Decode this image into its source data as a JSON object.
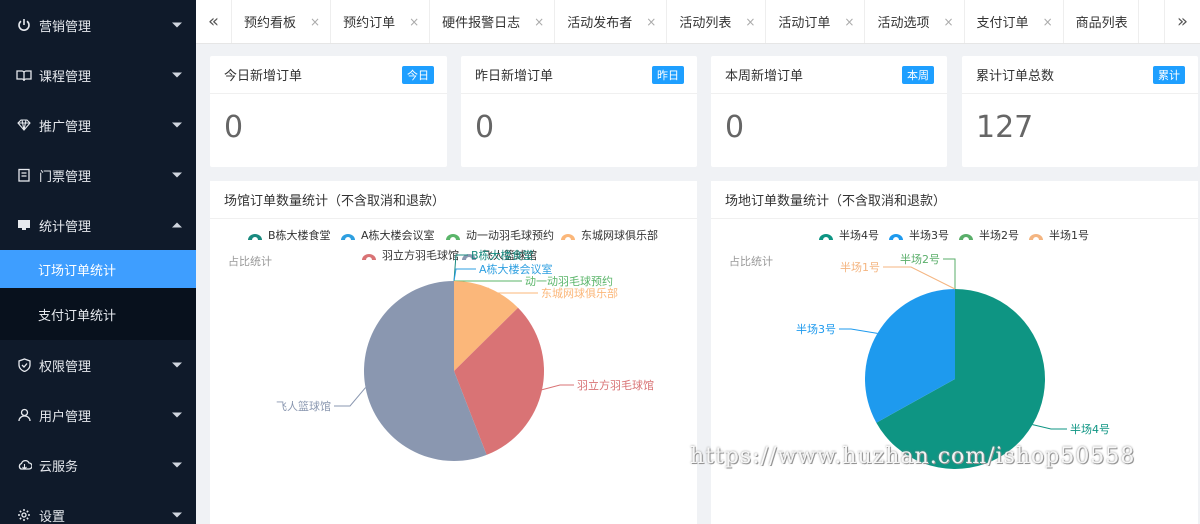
{
  "sidebar": {
    "items": [
      {
        "label": "营销管理",
        "icon": "power-icon",
        "expanded": false
      },
      {
        "label": "课程管理",
        "icon": "book-icon",
        "expanded": false
      },
      {
        "label": "推广管理",
        "icon": "diamond-icon",
        "expanded": false
      },
      {
        "label": "门票管理",
        "icon": "ticket-icon",
        "expanded": false
      },
      {
        "label": "统计管理",
        "icon": "chart-icon",
        "expanded": true
      },
      {
        "label": "权限管理",
        "icon": "shield-icon",
        "expanded": false
      },
      {
        "label": "用户管理",
        "icon": "user-icon",
        "expanded": false
      },
      {
        "label": "云服务",
        "icon": "cloud-icon",
        "expanded": false
      },
      {
        "label": "设置",
        "icon": "gear-icon",
        "expanded": false
      }
    ],
    "submenu": [
      "订场订单统计",
      "支付订单统计"
    ]
  },
  "tabs": {
    "prev": "«",
    "next": "»",
    "close": "×",
    "items": [
      "预约看板",
      "预约订单",
      "硬件报警日志",
      "活动发布者",
      "活动列表",
      "活动订单",
      "活动选项",
      "支付订单",
      "商品列表"
    ]
  },
  "cards": [
    {
      "title": "今日新增订单",
      "badge": "今日",
      "value": "0"
    },
    {
      "title": "昨日新增订单",
      "badge": "昨日",
      "value": "0"
    },
    {
      "title": "本周新增订单",
      "badge": "本周",
      "value": "0"
    },
    {
      "title": "累计订单总数",
      "badge": "累计",
      "value": "127"
    }
  ],
  "panels": [
    {
      "title": "场馆订单数量统计（不含取消和退款）",
      "subtitle": "占比统计"
    },
    {
      "title": "场地订单数量统计（不含取消和退款）",
      "subtitle": "占比统计"
    }
  ],
  "colors": {
    "accent": "#1e9fff",
    "sidebar": "#0f1a2a",
    "active": "#3e9eff"
  },
  "chart_data": [
    {
      "type": "pie",
      "title": "场馆订单数量统计（不含取消和退款）",
      "subtitle": "占比统计",
      "legend_position": "top",
      "slices": [
        {
          "name": "B栋大楼食堂",
          "value": 0,
          "color": "#1a8a7f"
        },
        {
          "name": "A栋大楼会议室",
          "value": 0,
          "color": "#2e9fe0"
        },
        {
          "name": "动一动羽毛球预约",
          "value": 0,
          "color": "#5bb56a"
        },
        {
          "name": "东城网球俱乐部",
          "value": 16,
          "color": "#fbb77a"
        },
        {
          "name": "羽立方羽毛球馆",
          "value": 40,
          "color": "#d97375"
        },
        {
          "name": "飞人篮球馆",
          "value": 71,
          "color": "#8a97b0"
        }
      ]
    },
    {
      "type": "pie",
      "title": "场地订单数量统计（不含取消和退款）",
      "subtitle": "占比统计",
      "legend_position": "top",
      "slices": [
        {
          "name": "半场4号",
          "value": 85,
          "color": "#0e9583"
        },
        {
          "name": "半场3号",
          "value": 42,
          "color": "#1e9aee"
        },
        {
          "name": "半场2号",
          "value": 0,
          "color": "#5aae6a"
        },
        {
          "name": "半场1号",
          "value": 0,
          "color": "#f4b581"
        }
      ]
    }
  ],
  "watermark": "https://www.huzhan.com/ishop50558"
}
